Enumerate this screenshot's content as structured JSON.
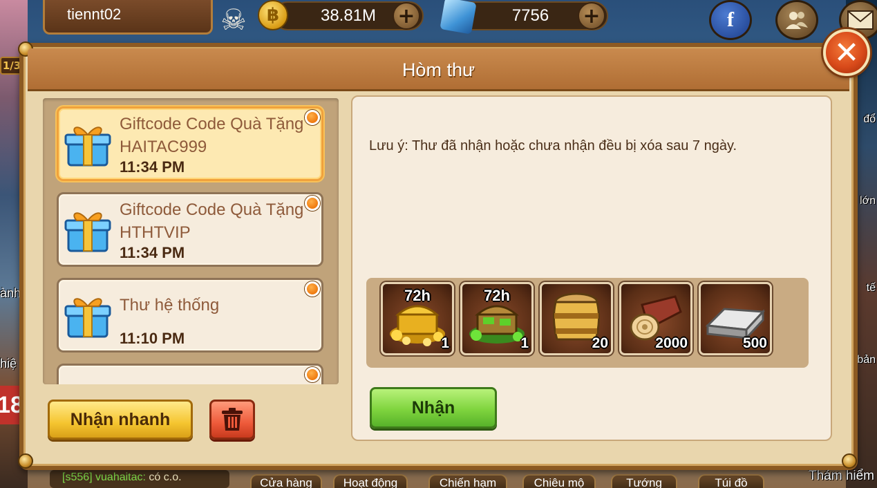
{
  "hud": {
    "username": "tiennt02",
    "gold": "38.81M",
    "gems": "7756",
    "level_tag": "1/3",
    "vip_number": "18",
    "side_labels_left": [
      "ành",
      "hiệ"
    ],
    "side_labels_right": [
      "đổ",
      "lớn",
      "tế",
      "bản"
    ]
  },
  "chat": {
    "server": "[s556] vuahaitac:",
    "message": "có c.o."
  },
  "bottom_nav": {
    "tabs": [
      "Cửa hàng",
      "Hoạt động",
      "Chiến hạm",
      "Chiêu mộ",
      "Tướng",
      "Túi đồ"
    ],
    "explore": "Thám hiểm"
  },
  "dialog": {
    "title": "Hòm thư",
    "close_icon": "close-icon"
  },
  "mail_list": [
    {
      "title": "Giftcode Code Quà Tặng HAITAC999",
      "time": "11:34 PM",
      "selected": true,
      "unread": true
    },
    {
      "title": "Giftcode Code Quà Tặng HTHTVIP",
      "time": "11:34 PM",
      "selected": false,
      "unread": true
    },
    {
      "title": "Thư hệ thống",
      "time": "11:10 PM",
      "selected": false,
      "unread": true
    },
    {
      "title": "",
      "time": "",
      "selected": false,
      "unread": true
    }
  ],
  "actions": {
    "quick_claim": "Nhận nhanh",
    "delete_icon": "trash-icon",
    "claim": "Nhận"
  },
  "detail": {
    "notice": "Lưu ý: Thư đã nhận hoặc chưa nhận đều bị xóa sau 7 ngày.",
    "rewards": [
      {
        "icon": "gold-treasure-chest-icon",
        "duration": "72h",
        "qty": "1"
      },
      {
        "icon": "green-treasure-chest-icon",
        "duration": "72h",
        "qty": "1"
      },
      {
        "icon": "wooden-barrel-icon",
        "duration": "",
        "qty": "20"
      },
      {
        "icon": "wood-log-icon",
        "duration": "",
        "qty": "2000"
      },
      {
        "icon": "iron-ingot-icon",
        "duration": "",
        "qty": "500"
      }
    ]
  },
  "colors": {
    "dialog_bg": "#e9d6ad",
    "header": "#b06e34",
    "selected_border": "#f0a23c",
    "unread_dot": "#ef7a0f",
    "claim_green": "#7fd43e",
    "quick_yellow": "#f5c530",
    "delete_red": "#ee5a3a",
    "close_red": "#d84a1a"
  }
}
